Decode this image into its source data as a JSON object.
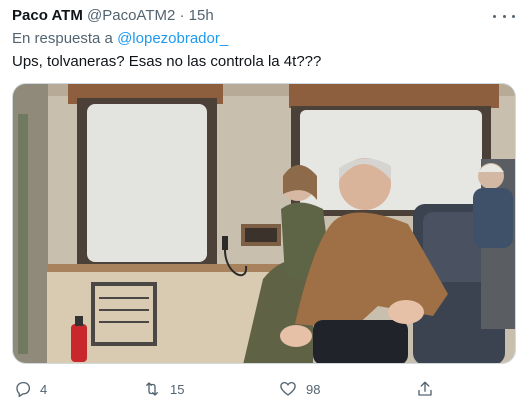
{
  "tweet": {
    "author_name": "Paco ATM",
    "author_handle": "@PacoATM2",
    "separator": "·",
    "time": "15h",
    "reply_prefix": "En respuesta a",
    "reply_to": "@lopezobrador_",
    "text": "Ups, tolvaneras? Esas no las controla la 4t???",
    "more_icon": "more-horizontal-icon"
  },
  "actions": {
    "reply": {
      "icon": "reply-icon",
      "count": "4"
    },
    "retweet": {
      "icon": "retweet-icon",
      "count": "15"
    },
    "like": {
      "icon": "heart-icon",
      "count": "98"
    },
    "share": {
      "icon": "share-icon"
    }
  },
  "colors": {
    "text": "#0f1419",
    "secondary": "#536471",
    "link": "#1d9bf0",
    "border": "#cfd9de"
  }
}
